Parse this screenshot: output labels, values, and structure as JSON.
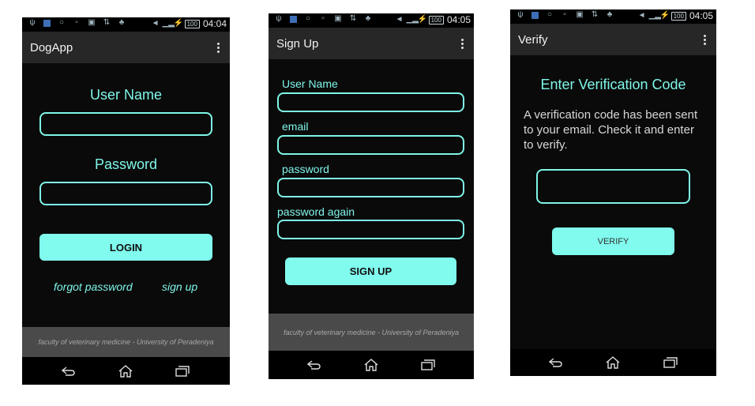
{
  "status": {
    "phone1_time": "04:04",
    "phone2_time": "04:05",
    "phone3_time": "04:05",
    "battery": "100"
  },
  "login": {
    "app_title": "DogApp",
    "username_label": "User Name",
    "password_label": "Password",
    "login_button": "LOGIN",
    "forgot_password": "forgot password",
    "sign_up_link": "sign up",
    "footer": "faculty of veterinary medicine - University of Peradeniya"
  },
  "signup": {
    "title": "Sign Up",
    "username_label": "User Name",
    "email_label": "email",
    "password_label": "password",
    "password_again_label": "password again",
    "signup_button": "SIGN UP",
    "footer": "faculty of veterinary medicine - University of Peradeniya"
  },
  "verify": {
    "title": "Verify",
    "heading": "Enter Verification Code",
    "message": "A verification code has been sent to your email. Check it and enter to verify.",
    "verify_button": "VERIFY"
  },
  "colors": {
    "accent": "#80fbee",
    "background": "#0a0a0a",
    "actionbar": "#272727",
    "footer": "#4a4a4a"
  },
  "icons": [
    "usb-icon",
    "notification-icon",
    "bulb-icon",
    "image-icon",
    "wifi-icon",
    "data-icon",
    "android-icon",
    "mute-icon",
    "signal-icon",
    "charging-icon",
    "battery-icon",
    "back-icon",
    "home-icon",
    "recents-icon",
    "overflow-menu-icon"
  ]
}
